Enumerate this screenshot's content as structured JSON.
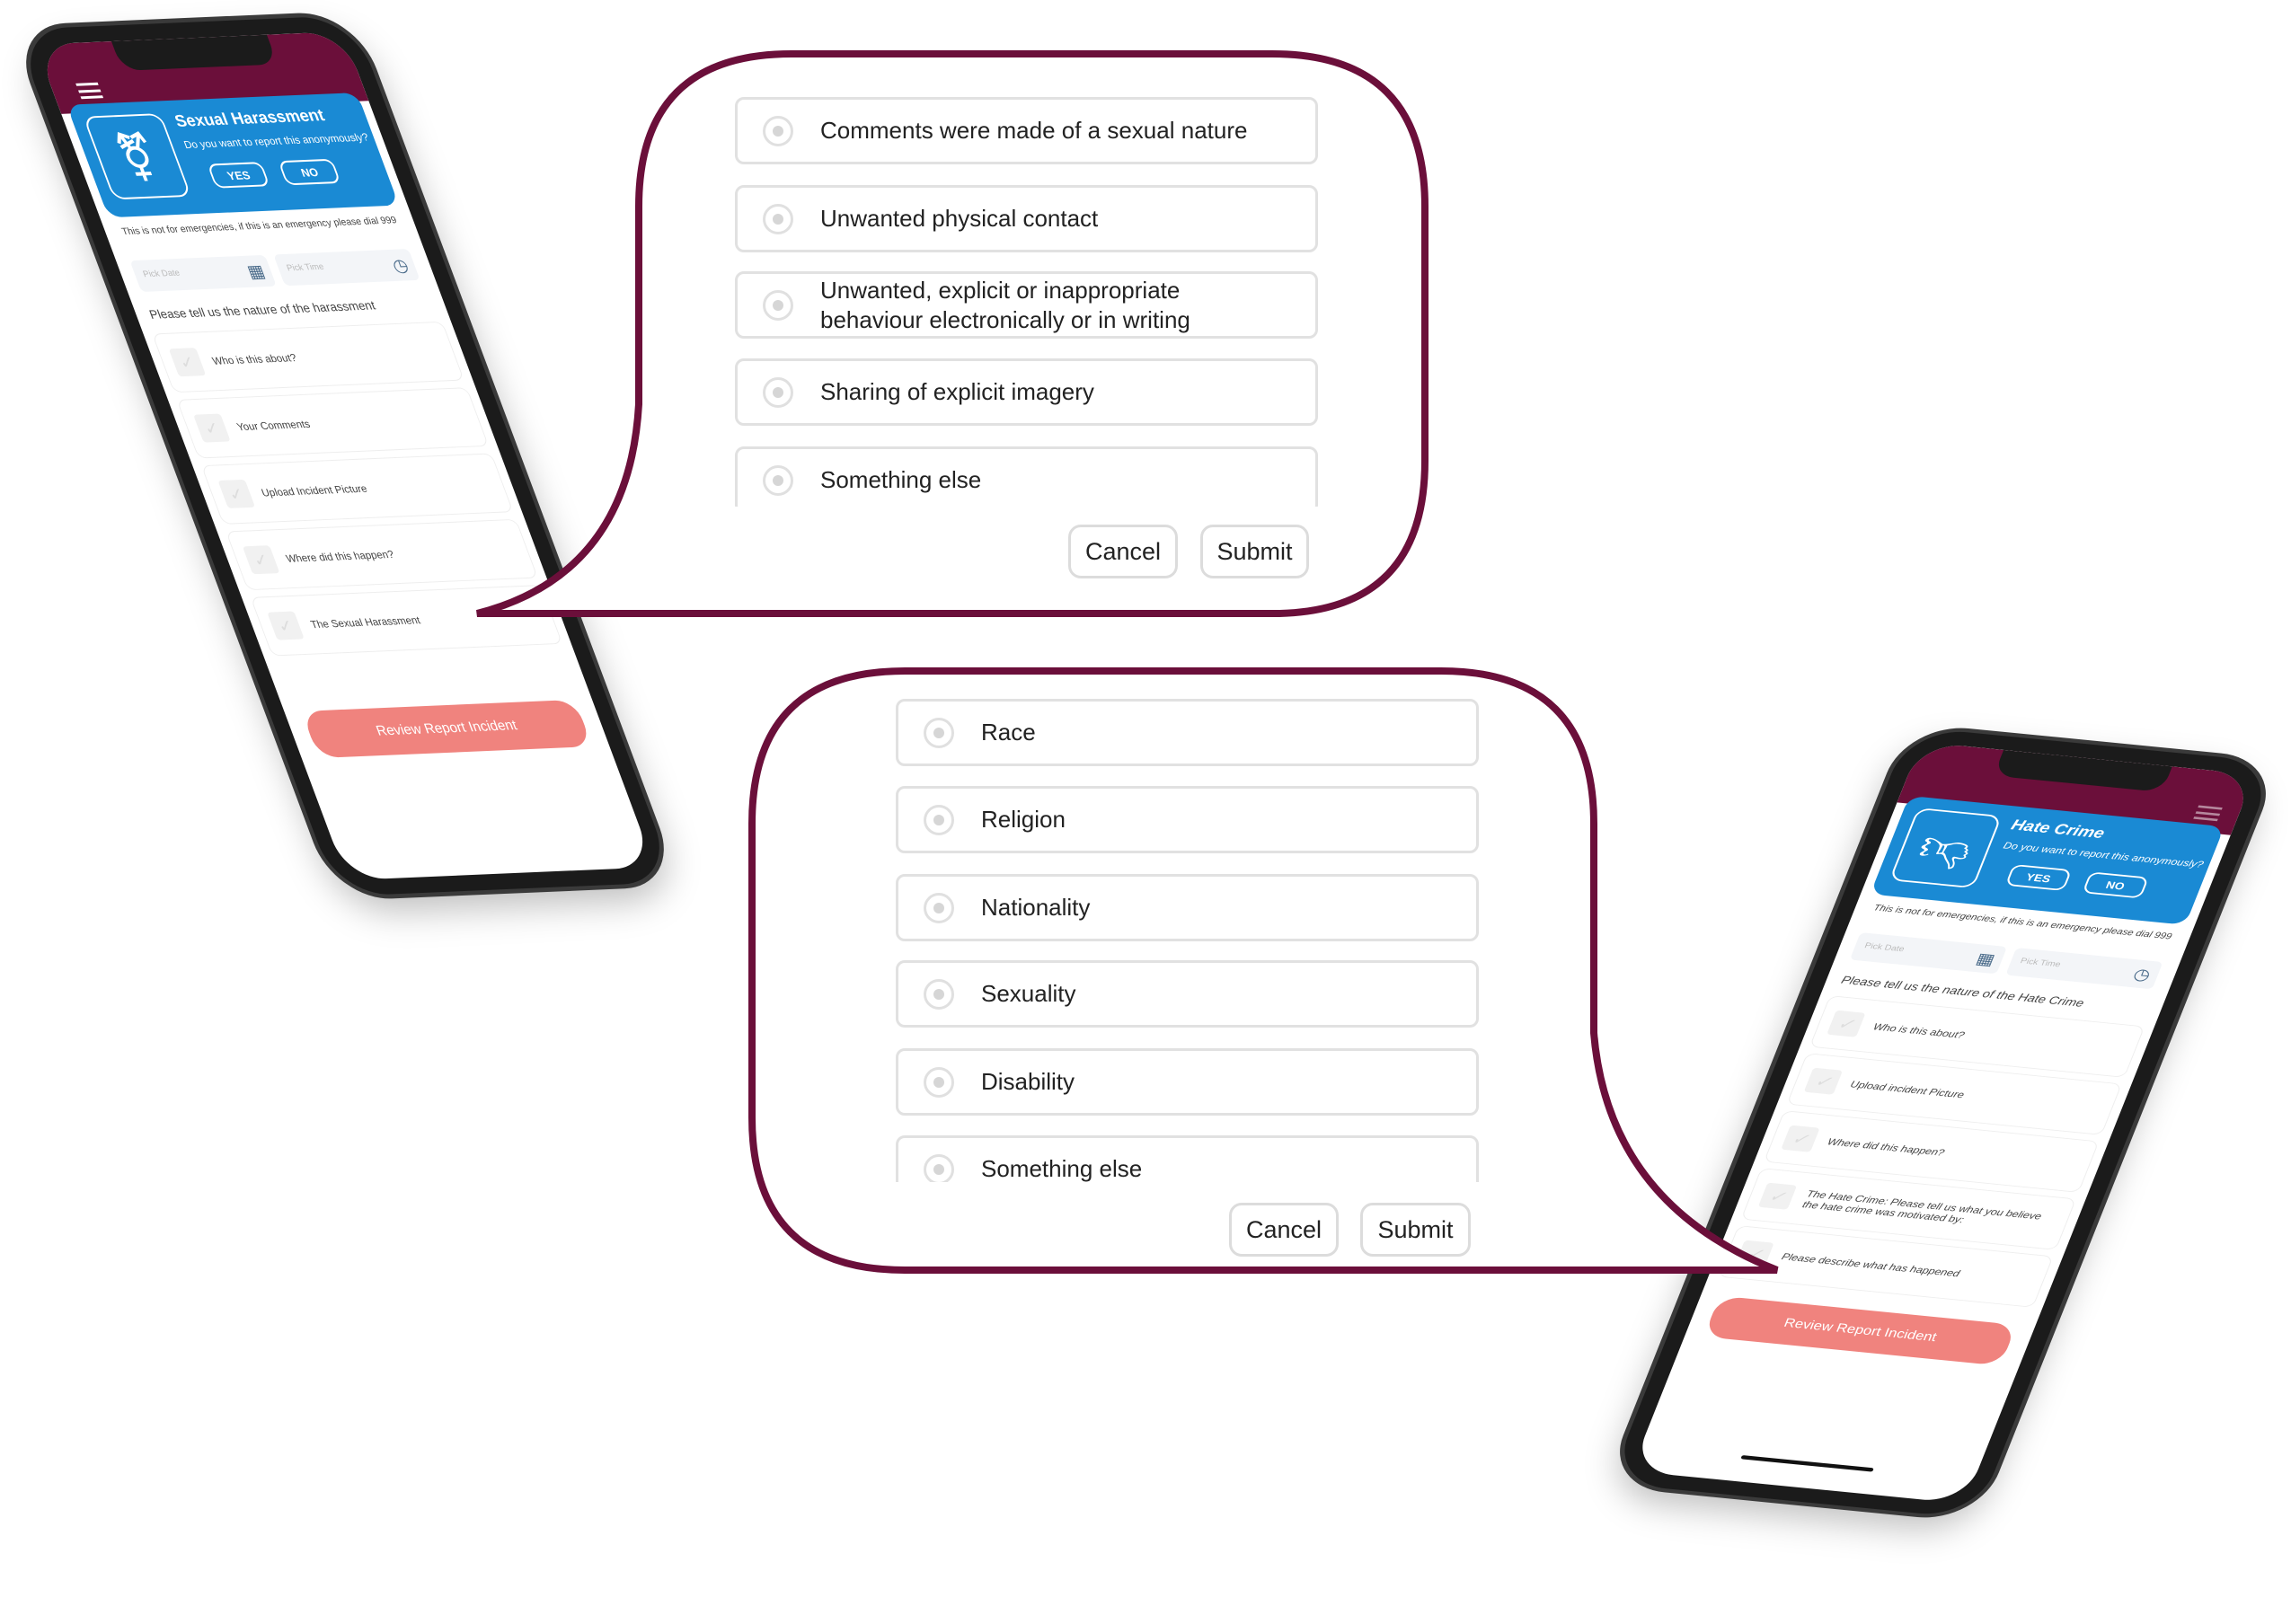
{
  "colors": {
    "maroon": "#6b0f3a",
    "blue": "#1a8ad4",
    "coral": "#f0837e"
  },
  "phones": [
    {
      "title": "Sexual Harassment",
      "question": "Do you want to report this anonymously?",
      "yes": "YES",
      "no": "NO",
      "icon": "gender-symbol-icon",
      "disclaimer": "This is not for emergencies, if this is an emergency please dial 999",
      "date_placeholder": "Pick Date",
      "time_placeholder": "Pick Time",
      "heading": "Please tell us the nature of the harassment",
      "items": [
        "Who is this about?",
        "Your Comments",
        "Upload Incident Picture",
        "Where did this happen?",
        "The Sexual Harassment"
      ],
      "review": "Review Report Incident"
    },
    {
      "title": "Hate Crime",
      "question": "Do you want to report this anonymously?",
      "yes": "YES",
      "no": "NO",
      "icon": "thumbs-down-icon",
      "disclaimer": "This is not for emergencies, if this is an emergency please dial 999",
      "date_placeholder": "Pick Date",
      "time_placeholder": "Pick Time",
      "heading": "Please tell us the nature of the Hate Crime",
      "items": [
        "Who is this about?",
        "Upload incident Picture",
        "Where did this happen?",
        "The Hate Crime: Please tell us what you believe the hate crime was motivated by:",
        "Please describe what has happened"
      ],
      "review": "Review Report Incident"
    }
  ],
  "bubbles": [
    {
      "options": [
        "Comments were made of a sexual nature",
        "Unwanted physical contact",
        "Unwanted, explicit or inappropriate behaviour electronically or in writing",
        "Sharing of explicit imagery",
        "Something else"
      ],
      "cancel": "Cancel",
      "submit": "Submit"
    },
    {
      "options": [
        "Race",
        "Religion",
        "Nationality",
        "Sexuality",
        "Disability",
        "Something else"
      ],
      "cancel": "Cancel",
      "submit": "Submit"
    }
  ]
}
